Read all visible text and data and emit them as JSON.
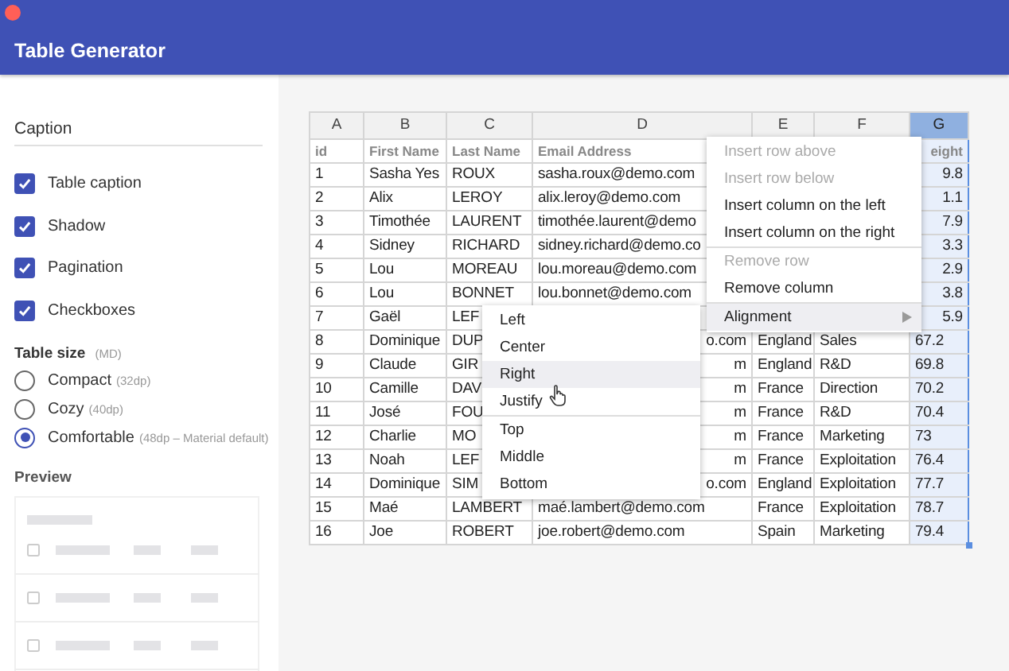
{
  "app": {
    "title": "Table Generator"
  },
  "sidebar": {
    "caption_field": {
      "placeholder": "Caption"
    },
    "checkboxes": [
      {
        "label": "Table caption",
        "checked": true
      },
      {
        "label": "Shadow",
        "checked": true
      },
      {
        "label": "Pagination",
        "checked": true
      },
      {
        "label": "Checkboxes",
        "checked": true
      }
    ],
    "table_size": {
      "label": "Table size",
      "hint": "(MD)",
      "options": [
        {
          "label": "Compact",
          "hint": "(32dp)",
          "selected": false
        },
        {
          "label": "Cozy",
          "hint": "(40dp)",
          "selected": false
        },
        {
          "label": "Comfortable",
          "hint": "(48dp – Material default)",
          "selected": true
        }
      ]
    },
    "preview": {
      "label": "Preview"
    }
  },
  "sheet": {
    "columns": [
      {
        "letter": "A",
        "selected": false
      },
      {
        "letter": "B",
        "selected": false
      },
      {
        "letter": "C",
        "selected": false
      },
      {
        "letter": "D",
        "selected": false
      },
      {
        "letter": "E",
        "selected": false
      },
      {
        "letter": "F",
        "selected": false
      },
      {
        "letter": "G",
        "selected": true
      }
    ],
    "header_row": {
      "id": "id",
      "first_name": "First Name",
      "last_name": "Last Name",
      "email": "Email Address",
      "column_7": {
        "text": "eight",
        "clipped_left": true
      }
    },
    "rows": [
      {
        "id": "1",
        "first_name": "Sasha Yes",
        "last_name": "ROUX",
        "email": "sasha.roux@demo.com",
        "column_7": {
          "text": "9.8",
          "clipped_left": true
        }
      },
      {
        "id": "2",
        "first_name": "Alix",
        "last_name": "LEROY",
        "email": "alix.leroy@demo.com",
        "column_7": {
          "text": "1.1",
          "clipped_left": true
        }
      },
      {
        "id": "3",
        "first_name": "Timothée",
        "last_name": "LAURENT",
        "email": "timothée.laurent@demo",
        "column_7": {
          "text": "7.9",
          "clipped_left": true
        }
      },
      {
        "id": "4",
        "first_name": "Sidney",
        "last_name": "RICHARD",
        "email": "sidney.richard@demo.co",
        "column_7": {
          "text": "3.3",
          "clipped_left": true
        }
      },
      {
        "id": "5",
        "first_name": "Lou",
        "last_name": "MOREAU",
        "email": "lou.moreau@demo.com",
        "column_7": {
          "text": "2.9",
          "clipped_left": true
        }
      },
      {
        "id": "6",
        "first_name": "Lou",
        "last_name": "BONNET",
        "email": "lou.bonnet@demo.com",
        "column_7": {
          "text": "3.8",
          "clipped_left": true
        }
      },
      {
        "id": "7",
        "first_name": "Gaël",
        "last_name": "LEF",
        "column_7": {
          "text": "5.9",
          "clipped_left": true
        }
      },
      {
        "id": "8",
        "first_name": "Dominique",
        "last_name": "DUP",
        "email": {
          "text": "o.com",
          "clipped_left": true
        },
        "column_5": "England",
        "column_6": "Sales",
        "column_7": "67.2"
      },
      {
        "id": "9",
        "first_name": "Claude",
        "last_name": "GIR",
        "email": {
          "text": "m",
          "clipped_left": true
        },
        "column_5": "England",
        "column_6": "R&D",
        "column_7": "69.8"
      },
      {
        "id": "10",
        "first_name": "Camille",
        "last_name": "DAV",
        "email": {
          "text": "m",
          "clipped_left": true
        },
        "column_5": "France",
        "column_6": "Direction",
        "column_7": "70.2"
      },
      {
        "id": "11",
        "first_name": "José",
        "last_name": "FOU",
        "email": {
          "text": "m",
          "clipped_left": true
        },
        "column_5": "France",
        "column_6": "R&D",
        "column_7": "70.4"
      },
      {
        "id": "12",
        "first_name": "Charlie",
        "last_name": "MO",
        "email": {
          "text": "m",
          "clipped_left": true
        },
        "column_5": "France",
        "column_6": "Marketing",
        "column_7": "73"
      },
      {
        "id": "13",
        "first_name": "Noah",
        "last_name": "LEF",
        "email": {
          "text": "m",
          "clipped_left": true
        },
        "column_5": "France",
        "column_6": "Exploitation",
        "column_7": "76.4"
      },
      {
        "id": "14",
        "first_name": "Dominique",
        "last_name": "SIM",
        "email": {
          "text": "o.com",
          "clipped_left": true
        },
        "column_5": "England",
        "column_6": "Exploitation",
        "column_7": "77.7"
      },
      {
        "id": "15",
        "first_name": "Maé",
        "last_name": "LAMBERT",
        "email": "maé.lambert@demo.com",
        "column_5": "France",
        "column_6": "Exploitation",
        "column_7": "78.7"
      },
      {
        "id": "16",
        "first_name": "Joe",
        "last_name": "ROBERT",
        "email": "joe.robert@demo.com",
        "column_5": "Spain",
        "column_6": "Marketing",
        "column_7": "79.4"
      }
    ]
  },
  "context_menu": {
    "items": [
      {
        "kind": "item",
        "label": "Insert row above",
        "disabled": true
      },
      {
        "kind": "item",
        "label": "Insert row below",
        "disabled": true
      },
      {
        "kind": "item",
        "label": "Insert column on the left",
        "disabled": false
      },
      {
        "kind": "item",
        "label": "Insert column on the right",
        "disabled": false
      },
      {
        "kind": "divider"
      },
      {
        "kind": "item",
        "label": "Remove row",
        "disabled": true
      },
      {
        "kind": "item",
        "label": "Remove column",
        "disabled": false
      },
      {
        "kind": "divider"
      },
      {
        "kind": "submenu",
        "label": "Alignment",
        "disabled": false,
        "expanded": true
      }
    ]
  },
  "alignment_menu": {
    "items": [
      {
        "kind": "item",
        "label": "Left",
        "selected": false
      },
      {
        "kind": "item",
        "label": "Center",
        "selected": false
      },
      {
        "kind": "item",
        "label": "Right",
        "selected": true
      },
      {
        "kind": "item",
        "label": "Justify",
        "selected": false
      },
      {
        "kind": "divider"
      },
      {
        "kind": "item",
        "label": "Top",
        "selected": false
      },
      {
        "kind": "item",
        "label": "Middle",
        "selected": false
      },
      {
        "kind": "item",
        "label": "Bottom",
        "selected": false
      }
    ]
  }
}
